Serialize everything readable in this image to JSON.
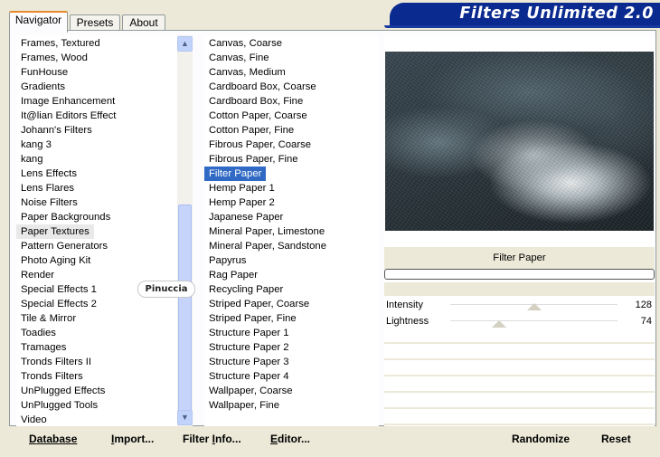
{
  "app": {
    "title": "Filters Unlimited 2.0"
  },
  "tabs": [
    {
      "label": "Navigator",
      "active": true
    },
    {
      "label": "Presets",
      "active": false
    },
    {
      "label": "About",
      "active": false
    }
  ],
  "categories": {
    "items": [
      "Frames, Textured",
      "Frames, Wood",
      "FunHouse",
      "Gradients",
      "Image Enhancement",
      "It@lian Editors Effect",
      "Johann's Filters",
      "kang 3",
      "kang",
      "Lens Effects",
      "Lens Flares",
      "Noise Filters",
      "Paper Backgrounds",
      "Paper Textures",
      "Pattern Generators",
      "Photo Aging Kit",
      "Render",
      "Special Effects 1",
      "Special Effects 2",
      "Tile & Mirror",
      "Toadies",
      "Tramages",
      "Tronds Filters II",
      "Tronds Filters",
      "UnPlugged Effects",
      "UnPlugged Tools",
      "Video"
    ],
    "selected": "Paper Textures"
  },
  "filters": {
    "items": [
      "Canvas, Coarse",
      "Canvas, Fine",
      "Canvas, Medium",
      "Cardboard Box, Coarse",
      "Cardboard Box, Fine",
      "Cotton Paper, Coarse",
      "Cotton Paper, Fine",
      "Fibrous Paper, Coarse",
      "Fibrous Paper, Fine",
      "Filter Paper",
      "Hemp Paper 1",
      "Hemp Paper 2",
      "Japanese Paper",
      "Mineral Paper, Limestone",
      "Mineral Paper, Sandstone",
      "Papyrus",
      "Rag Paper",
      "Recycling Paper",
      "Striped Paper, Coarse",
      "Striped Paper, Fine",
      "Structure Paper 1",
      "Structure Paper 2",
      "Structure Paper 3",
      "Structure Paper 4",
      "Wallpaper, Coarse",
      "Wallpaper, Fine"
    ],
    "selected": "Filter Paper"
  },
  "watermark": "Pinuccia",
  "preview": {
    "filter_name": "Filter Paper"
  },
  "params": [
    {
      "label": "Intensity",
      "value": "128",
      "level": 128,
      "max": 255
    },
    {
      "label": "Lightness",
      "value": "74",
      "level": 74,
      "max": 255
    }
  ],
  "buttons": {
    "database": {
      "first": "D",
      "rest": "atabase"
    },
    "import": {
      "first": "I",
      "rest": "mport..."
    },
    "filter_info": {
      "before": "Filter ",
      "first": "I",
      "rest": "nfo..."
    },
    "editor": {
      "first": "E",
      "rest": "ditor..."
    },
    "randomize": "Randomize",
    "reset": "Reset"
  },
  "colors": {
    "banner": "#0b2a8f",
    "selection": "#316ac5",
    "tab_accent": "#e68b2c"
  }
}
